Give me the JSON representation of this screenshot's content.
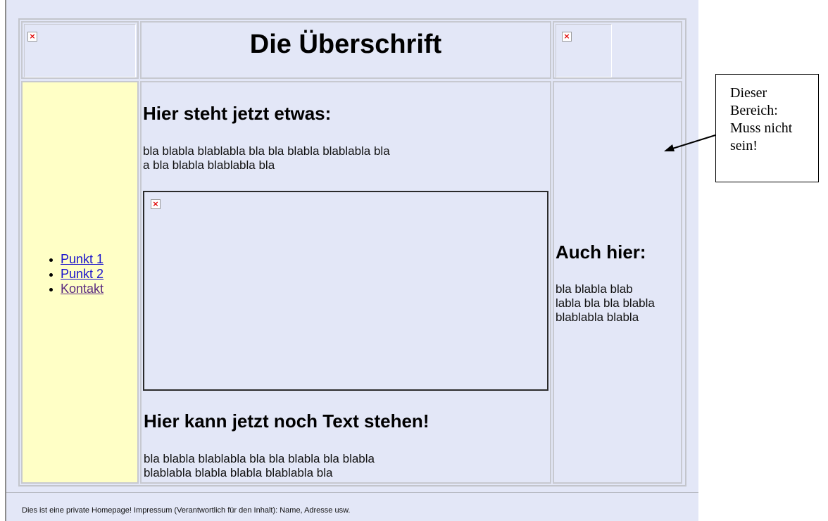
{
  "header": {
    "title": "Die Überschrift",
    "broken_image_glyph": "×"
  },
  "nav": {
    "items": [
      {
        "label": "Punkt 1",
        "visited": false
      },
      {
        "label": "Punkt 2",
        "visited": false
      },
      {
        "label": "Kontakt",
        "visited": true
      }
    ]
  },
  "content": {
    "heading1": "Hier steht jetzt etwas:",
    "paragraph1": "bla blabla blablabla bla bla blabla blablabla bla\na bla blabla blablabla bla",
    "heading2": "Hier kann jetzt noch Text stehen!",
    "paragraph2": "bla blabla blablabla bla bla blabla bla blabla\nblablabla blabla blabla blablabla bla"
  },
  "sidebar": {
    "heading": "Auch hier:",
    "paragraph": "bla blabla blab\nlabla bla bla blabla\nblablabla blabla"
  },
  "footer": {
    "text": "Dies ist eine private Homepage! Impressum (Verantwortlich für den Inhalt): Name, Adresse usw."
  },
  "callout": {
    "lines": [
      "Dieser",
      "Bereich:",
      "Muss nicht",
      "sein!"
    ]
  },
  "colors": {
    "page_background": "#e3e7f7",
    "nav_background": "#ffffc6",
    "link": "#1a13cc",
    "visited_link": "#5a2a80",
    "broken_image_x": "#e00000"
  }
}
